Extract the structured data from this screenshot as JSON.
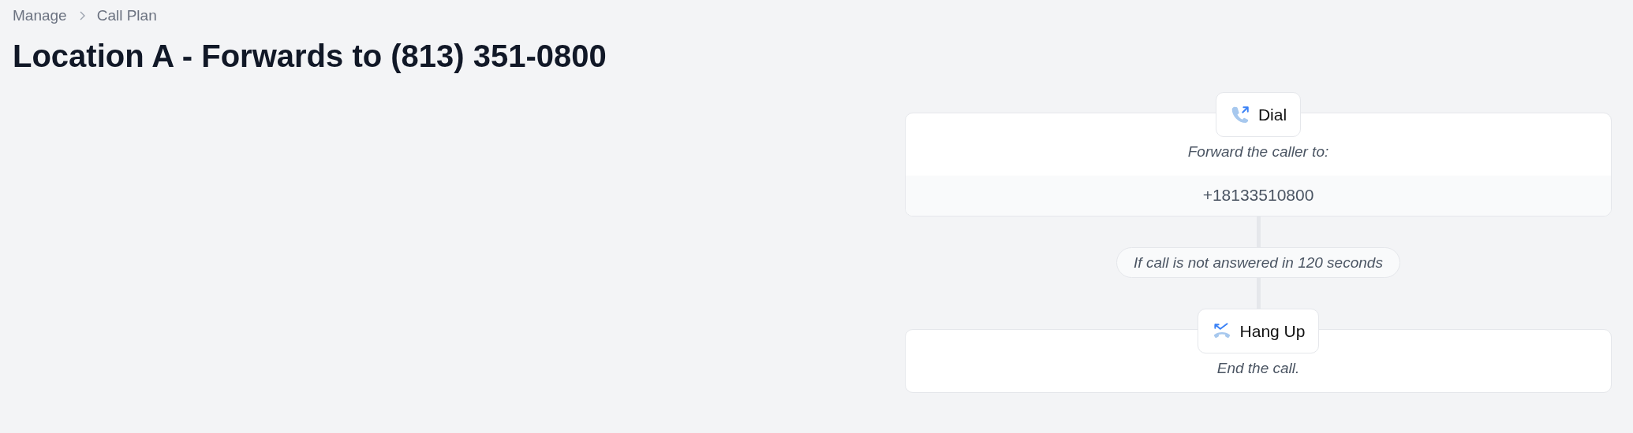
{
  "breadcrumb": [
    "Manage",
    "Call Plan"
  ],
  "title": "Location A - Forwards to (813) 351-0800",
  "flow": [
    {
      "kind": "dial",
      "label": "Dial",
      "description": "Forward the caller to:",
      "value": "+18133510800"
    },
    {
      "kind": "condition",
      "text": "If call is not answered in 120 seconds"
    },
    {
      "kind": "hangup",
      "label": "Hang Up",
      "description": "End the call."
    }
  ]
}
